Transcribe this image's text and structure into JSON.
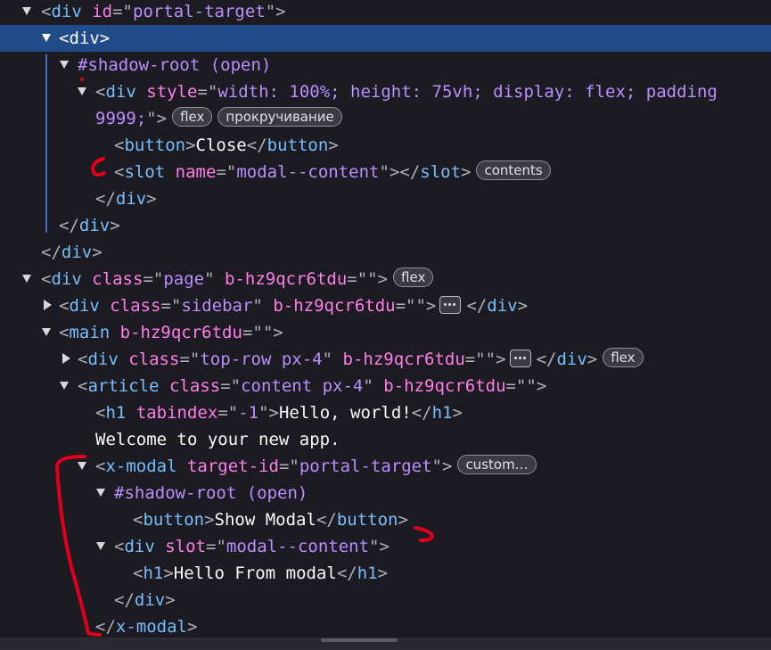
{
  "rows": [
    {
      "a": "<",
      "b": "div",
      "c": " id",
      "d": "=\"",
      "e": "portal-target",
      "f": "\">"
    },
    {
      "a": "<",
      "b": "div",
      "c": ">"
    },
    {
      "a": "#shadow-root",
      "b": "(open)"
    },
    {
      "a": "<",
      "b": "div",
      "c": "style",
      "d": "=\"",
      "e": "width: 100%; height: 75vh; display: flex; padding",
      "f": "9999;",
      "g": "\">",
      "badge1": "flex",
      "badge2": "прокручивание"
    },
    {
      "a": "<",
      "b": "button",
      "c": ">",
      "d": "Close",
      "e": "</",
      "f": "button",
      "g": ">"
    },
    {
      "a": "<",
      "b": "slot",
      "c": "name",
      "d": "=\"",
      "e": "modal--content",
      "f": "\">",
      "g": "</",
      "h": "slot",
      "i": ">",
      "badge": "contents"
    },
    {
      "a": "</",
      "b": "div",
      "c": ">"
    },
    {
      "a": "</",
      "b": "div",
      "c": ">"
    },
    {
      "a": "</",
      "b": "div",
      "c": ">"
    },
    {
      "a": "<",
      "b": "div",
      "c": "class",
      "d": "=\"",
      "e": "page",
      "f": "\"",
      "g": "b-hz9qcr6tdu",
      "h": "=\"\">",
      "badge": "flex"
    },
    {
      "a": "<",
      "b": "div",
      "c": "class",
      "d": "=\"",
      "e": "sidebar",
      "f": "\"",
      "g": "b-hz9qcr6tdu",
      "h": "=\"\">",
      "i": "</",
      "j": "div",
      "k": ">"
    },
    {
      "a": "<",
      "b": "main",
      "c": "b-hz9qcr6tdu",
      "d": "=\"\">"
    },
    {
      "a": "<",
      "b": "div",
      "c": "class",
      "d": "=\"",
      "e": "top-row px-4",
      "f": "\"",
      "g": "b-hz9qcr6tdu",
      "h": "=\"\">",
      "i": "</",
      "j": "div",
      "k": ">",
      "badge": "flex"
    },
    {
      "a": "<",
      "b": "article",
      "c": "class",
      "d": "=\"",
      "e": "content px-4",
      "f": "\"",
      "g": "b-hz9qcr6tdu",
      "h": "=\"\">"
    },
    {
      "a": "<",
      "b": "h1",
      "c": "tabindex",
      "d": "=\"",
      "e": "-1",
      "f": "\">",
      "g": "Hello, world!",
      "h": "</",
      "i": "h1",
      "j": ">"
    },
    {
      "a": "Welcome to your new app."
    },
    {
      "a": "<",
      "b": "x-modal",
      "c": "target-id",
      "d": "=\"",
      "e": "portal-target",
      "f": "\">",
      "badge": "custom…"
    },
    {
      "a": "#shadow-root",
      "b": "(open)"
    },
    {
      "a": "<",
      "b": "button",
      "c": ">",
      "d": "Show Modal",
      "e": "</",
      "f": "button",
      "g": ">"
    },
    {
      "a": "<",
      "b": "div",
      "c": "slot",
      "d": "=\"",
      "e": "modal--content",
      "f": "\">"
    },
    {
      "a": "<",
      "b": "h1",
      "c": ">",
      "d": "Hello From modal",
      "e": "</",
      "f": "h1",
      "g": ">"
    },
    {
      "a": "</",
      "b": "div",
      "c": ">"
    },
    {
      "a": "</",
      "b": "x-modal",
      "c": ">"
    }
  ],
  "colors": {
    "background": "#1c1b22",
    "selection": "#1f4b8b",
    "tag": "#75bfff",
    "attribute": "#ff7de9",
    "value": "#b98eff",
    "annotation": "#e0001b"
  }
}
